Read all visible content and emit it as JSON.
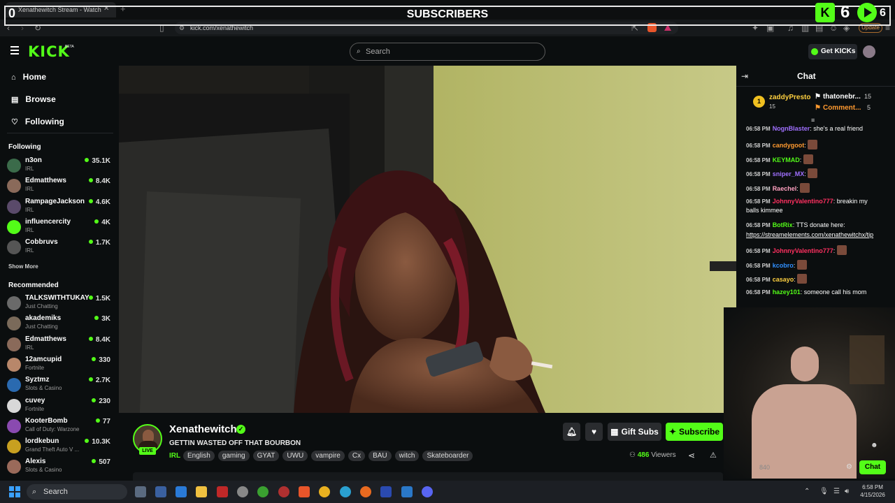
{
  "browser": {
    "tab_title": "Xenathewitch Stream - Watch",
    "url": "kick.com/xenathewitch",
    "update_label": "Update"
  },
  "overlay": {
    "title": "SUBSCRIBERS",
    "left_value": "0",
    "k_icon_label": "K",
    "kick_count": "6",
    "play_count": "6"
  },
  "header": {
    "logo": "KICK",
    "beta": "BETA",
    "search_placeholder": "Search",
    "get_kicks_label": "Get KICKs"
  },
  "sidebar": {
    "nav": [
      "Home",
      "Browse",
      "Following"
    ],
    "following_header": "Following",
    "following": [
      {
        "name": "n3on",
        "category": "IRL",
        "viewers": "35.1K",
        "color": "#3b6b4a"
      },
      {
        "name": "Edmatthews",
        "category": "IRL",
        "viewers": "8.4K",
        "color": "#8a6a5a"
      },
      {
        "name": "RampageJackson",
        "category": "IRL",
        "viewers": "4.6K",
        "color": "#5a4a6a"
      },
      {
        "name": "influencercity",
        "category": "IRL",
        "viewers": "4K",
        "color": "#53fc18"
      },
      {
        "name": "Cobbruvs",
        "category": "IRL",
        "viewers": "1.7K",
        "color": "#555555"
      }
    ],
    "show_more": "Show More",
    "recommended_header": "Recommended",
    "recommended": [
      {
        "name": "TALKSWITHTUKAY",
        "category": "Just Chatting",
        "viewers": "1.5K",
        "color": "#6a6a6a"
      },
      {
        "name": "akademiks",
        "category": "Just Chatting",
        "viewers": "3K",
        "color": "#7a6a5a"
      },
      {
        "name": "Edmatthews",
        "category": "IRL",
        "viewers": "8.4K",
        "color": "#8a6a5a"
      },
      {
        "name": "12amcupid",
        "category": "Fortnite",
        "viewers": "330",
        "color": "#b8876a"
      },
      {
        "name": "Syztmz",
        "category": "Slots & Casino",
        "viewers": "2.7K",
        "color": "#2a6ab0"
      },
      {
        "name": "cuvey",
        "category": "Fortnite",
        "viewers": "230",
        "color": "#d8d8d8"
      },
      {
        "name": "KooterBomb",
        "category": "Call of Duty: Warzone",
        "viewers": "77",
        "color": "#8a4ab0"
      },
      {
        "name": "lordkebun",
        "category": "Grand Theft Auto V ...",
        "viewers": "10.3K",
        "color": "#c8a020"
      },
      {
        "name": "Alexis",
        "category": "Slots & Casino",
        "viewers": "507",
        "color": "#9a6a5a"
      }
    ]
  },
  "stream": {
    "streamer": "Xenathewitch",
    "title": "GETTIN WASTED OFF THAT BOURBON",
    "live_label": "LIVE",
    "category": "IRL",
    "tags": [
      "English",
      "gaming",
      "GYAT",
      "UWU",
      "vampire",
      "Cx",
      "BAU",
      "witch",
      "Skateboarder"
    ],
    "viewers": "486",
    "viewers_label": "Viewers",
    "gift_subs_label": "Gift Subs",
    "subscribe_label": "Subscribe"
  },
  "chat": {
    "title": "Chat",
    "leaderboard": [
      {
        "rank": "1",
        "name": "zaddyPresto",
        "count": "15"
      },
      {
        "name": "thatonebr...",
        "count": "15"
      },
      {
        "name": "Comment...",
        "count": "5"
      }
    ],
    "messages": [
      {
        "time": "06:58 PM",
        "user": "NognBlaster",
        "color": "#a070ff",
        "text": "she's a real friend"
      },
      {
        "time": "06:58 PM",
        "user": "candygoot",
        "color": "#ff9a30",
        "text": ""
      },
      {
        "time": "06:58 PM",
        "user": "KEYMAD",
        "color": "#53fc18",
        "text": ""
      },
      {
        "time": "06:58 PM",
        "user": "sniper_MX",
        "color": "#a070ff",
        "text": ""
      },
      {
        "time": "06:58 PM",
        "user": "Raechel",
        "color": "#ffa0c0",
        "text": ""
      },
      {
        "time": "06:58 PM",
        "user": "JohnnyValentino777",
        "color": "#ff3060",
        "text": "breakin my"
      },
      {
        "time": "",
        "user": "",
        "color": "#ffffff",
        "text": "balls kimmee"
      },
      {
        "time": "06:58 PM",
        "user": "BotRix",
        "color": "#53fc18",
        "text": "TTS donate here:"
      },
      {
        "time": "",
        "user": "",
        "color": "#ffffff",
        "text": "https://streamelements.com/xenathewitchx/tip"
      },
      {
        "time": "06:58 PM",
        "user": "JohnnyValentino777",
        "color": "#ff3060",
        "text": ""
      },
      {
        "time": "06:58 PM",
        "user": "kcobro",
        "color": "#3090ff",
        "text": ""
      },
      {
        "time": "06:58 PM",
        "user": "casayo",
        "color": "#ffd040",
        "text": ""
      },
      {
        "time": "06:58 PM",
        "user": "hazey101",
        "color": "#53fc18",
        "text": "someone call his mom"
      }
    ],
    "chat_button": "Chat",
    "overlay_count": "840"
  },
  "taskbar": {
    "search_label": "Search",
    "time": "6:58 PM",
    "date": "4/15/2026"
  }
}
